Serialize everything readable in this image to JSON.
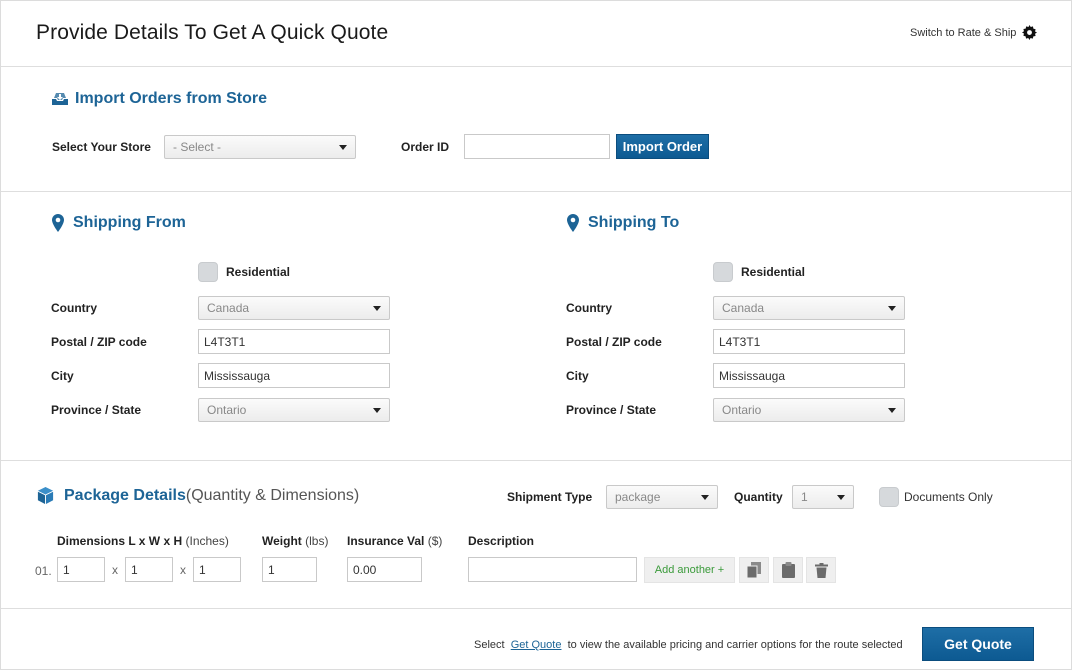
{
  "header": {
    "title": "Provide Details To Get A Quick Quote",
    "switch_label": "Switch to Rate & Ship",
    "switch_icon": "gear-icon"
  },
  "import": {
    "title": "Import Orders from Store",
    "store_label": "Select Your Store",
    "store_value": "- Select -",
    "order_id_label": "Order ID",
    "order_id_value": "",
    "import_button": "Import Order"
  },
  "shipping_from": {
    "title": "Shipping From",
    "residential_label": "Residential",
    "country_label": "Country",
    "country_value": "Canada",
    "postal_label": "Postal / ZIP code",
    "postal_value": "L4T3T1",
    "city_label": "City",
    "city_value": "Mississauga",
    "province_label": "Province / State",
    "province_value": "Ontario"
  },
  "shipping_to": {
    "title": "Shipping To",
    "residential_label": "Residential",
    "country_label": "Country",
    "country_value": "Canada",
    "postal_label": "Postal / ZIP code",
    "postal_value": "L4T3T1",
    "city_label": "City",
    "city_value": "Mississauga",
    "province_label": "Province / State",
    "province_value": "Ontario"
  },
  "package": {
    "title": "Package Details",
    "subtitle": "(Quantity & Dimensions)",
    "shipment_type_label": "Shipment Type",
    "shipment_type_value": "package",
    "quantity_label": "Quantity",
    "quantity_value": "1",
    "documents_only_label": "Documents Only",
    "dimensions_label": "Dimensions L x W x H",
    "dimensions_unit": "(Inches)",
    "weight_label": "Weight",
    "weight_unit": "(lbs)",
    "insurance_label": "Insurance Val",
    "insurance_unit": "($)",
    "description_label": "Description",
    "row": {
      "index": "01.",
      "length": "1",
      "width": "1",
      "height": "1",
      "sep": "x",
      "weight": "1",
      "insurance": "0.00",
      "description": ""
    },
    "add_another": "Add another +"
  },
  "footer": {
    "text_before": "Select",
    "link": "Get Quote",
    "text_after": "to view the available pricing and carrier options for the route selected",
    "get_quote_button": "Get Quote"
  },
  "colors": {
    "accent": "#1d6496",
    "button": "#0d5a92",
    "add_another": "#3a9a3a"
  }
}
